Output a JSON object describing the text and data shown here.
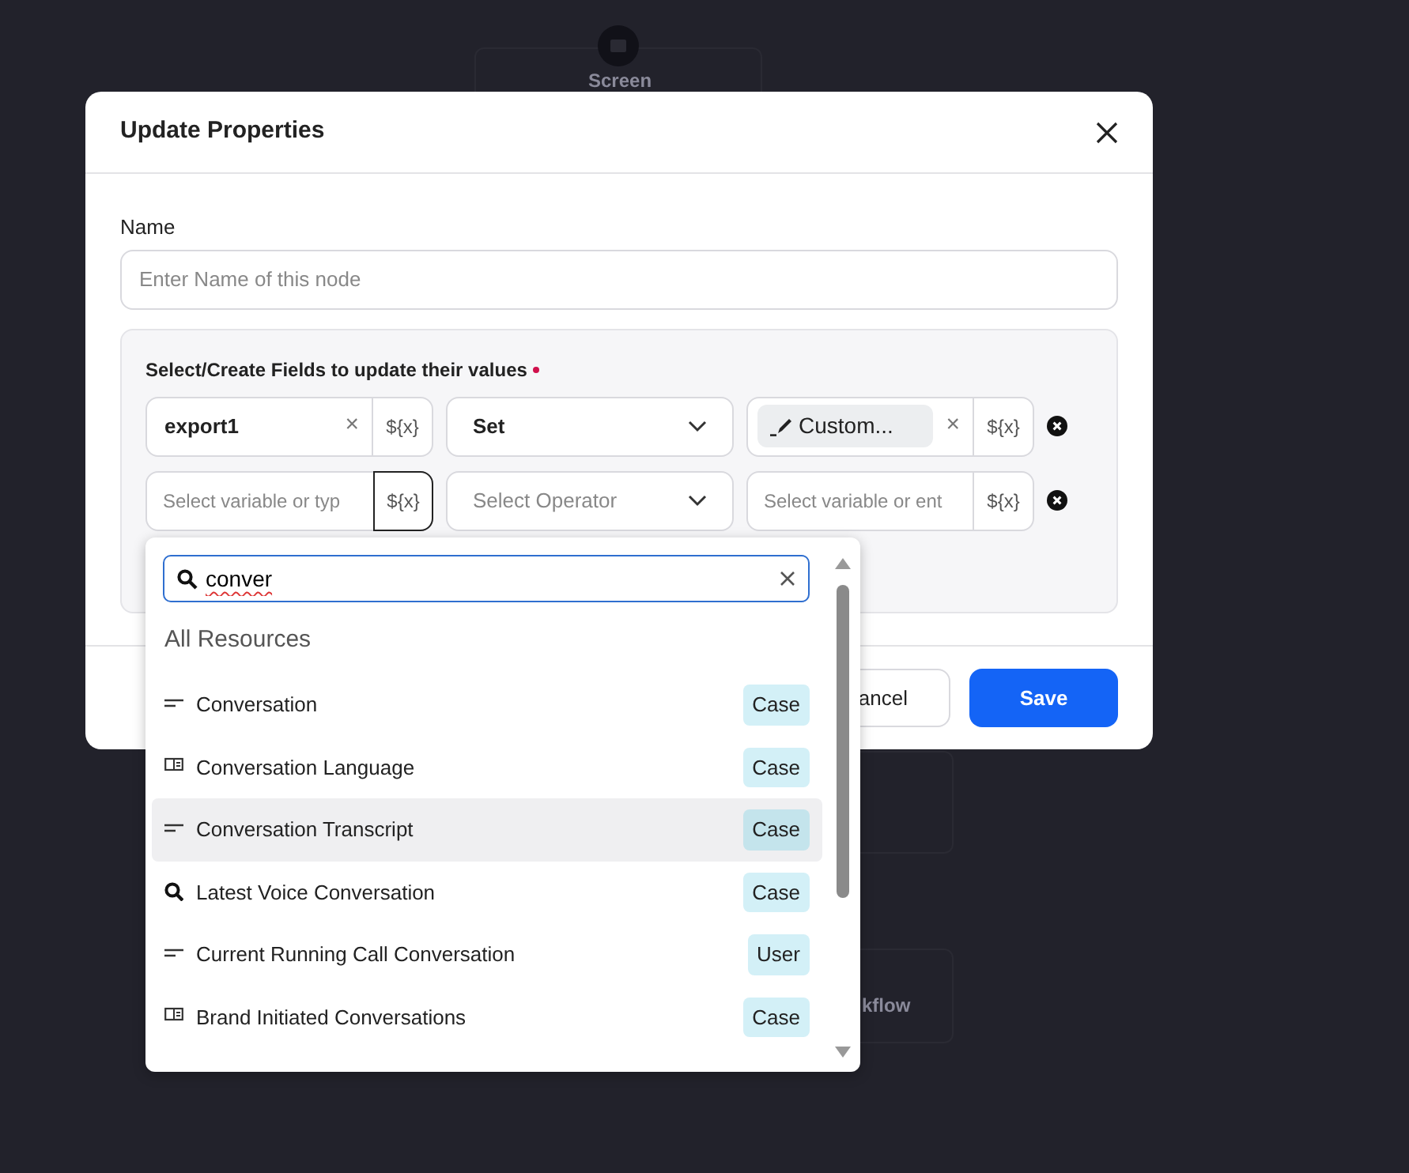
{
  "canvas": {
    "nodes": [
      {
        "label": "Screen",
        "kind": "top"
      },
      {
        "label": "kflow",
        "kind": "bottom"
      }
    ]
  },
  "modal": {
    "title": "Update Properties",
    "name_field": {
      "label": "Name",
      "placeholder": "Enter Name of this node"
    },
    "fields_panel": {
      "label": "Select/Create Fields to update their values",
      "required": true,
      "rows": [
        {
          "field": {
            "value": "export1",
            "clear": "×",
            "addon": "${x}",
            "focused": false
          },
          "operator": {
            "value": "Set"
          },
          "target": {
            "chip": "Custom...",
            "clear": "×",
            "addon": "${x}"
          }
        },
        {
          "field": {
            "placeholder": "Select variable or typ",
            "addon": "${x}",
            "focused": true
          },
          "operator": {
            "placeholder": "Select Operator"
          },
          "target": {
            "placeholder": "Select variable or ent",
            "addon": "${x}"
          }
        }
      ]
    },
    "buttons": [
      {
        "label": "ancel",
        "kind": "secondary"
      },
      {
        "label": "Save",
        "kind": "primary"
      }
    ]
  },
  "dropdown": {
    "search": {
      "value": "conver"
    },
    "heading": "All Resources",
    "items": [
      {
        "label": "Conversation",
        "kind": "text",
        "badge": "Case",
        "selected": false
      },
      {
        "label": "Conversation Language",
        "kind": "card",
        "badge": "Case",
        "selected": false
      },
      {
        "label": "Conversation Transcript",
        "kind": "text",
        "badge": "Case",
        "selected": true
      },
      {
        "label": "Latest Voice Conversation",
        "kind": "search",
        "badge": "Case",
        "selected": false
      },
      {
        "label": "Current Running Call Conversation",
        "kind": "text",
        "badge": "User",
        "selected": false
      },
      {
        "label": "Brand Initiated Conversations",
        "kind": "card",
        "badge": "Case",
        "selected": false
      }
    ]
  }
}
